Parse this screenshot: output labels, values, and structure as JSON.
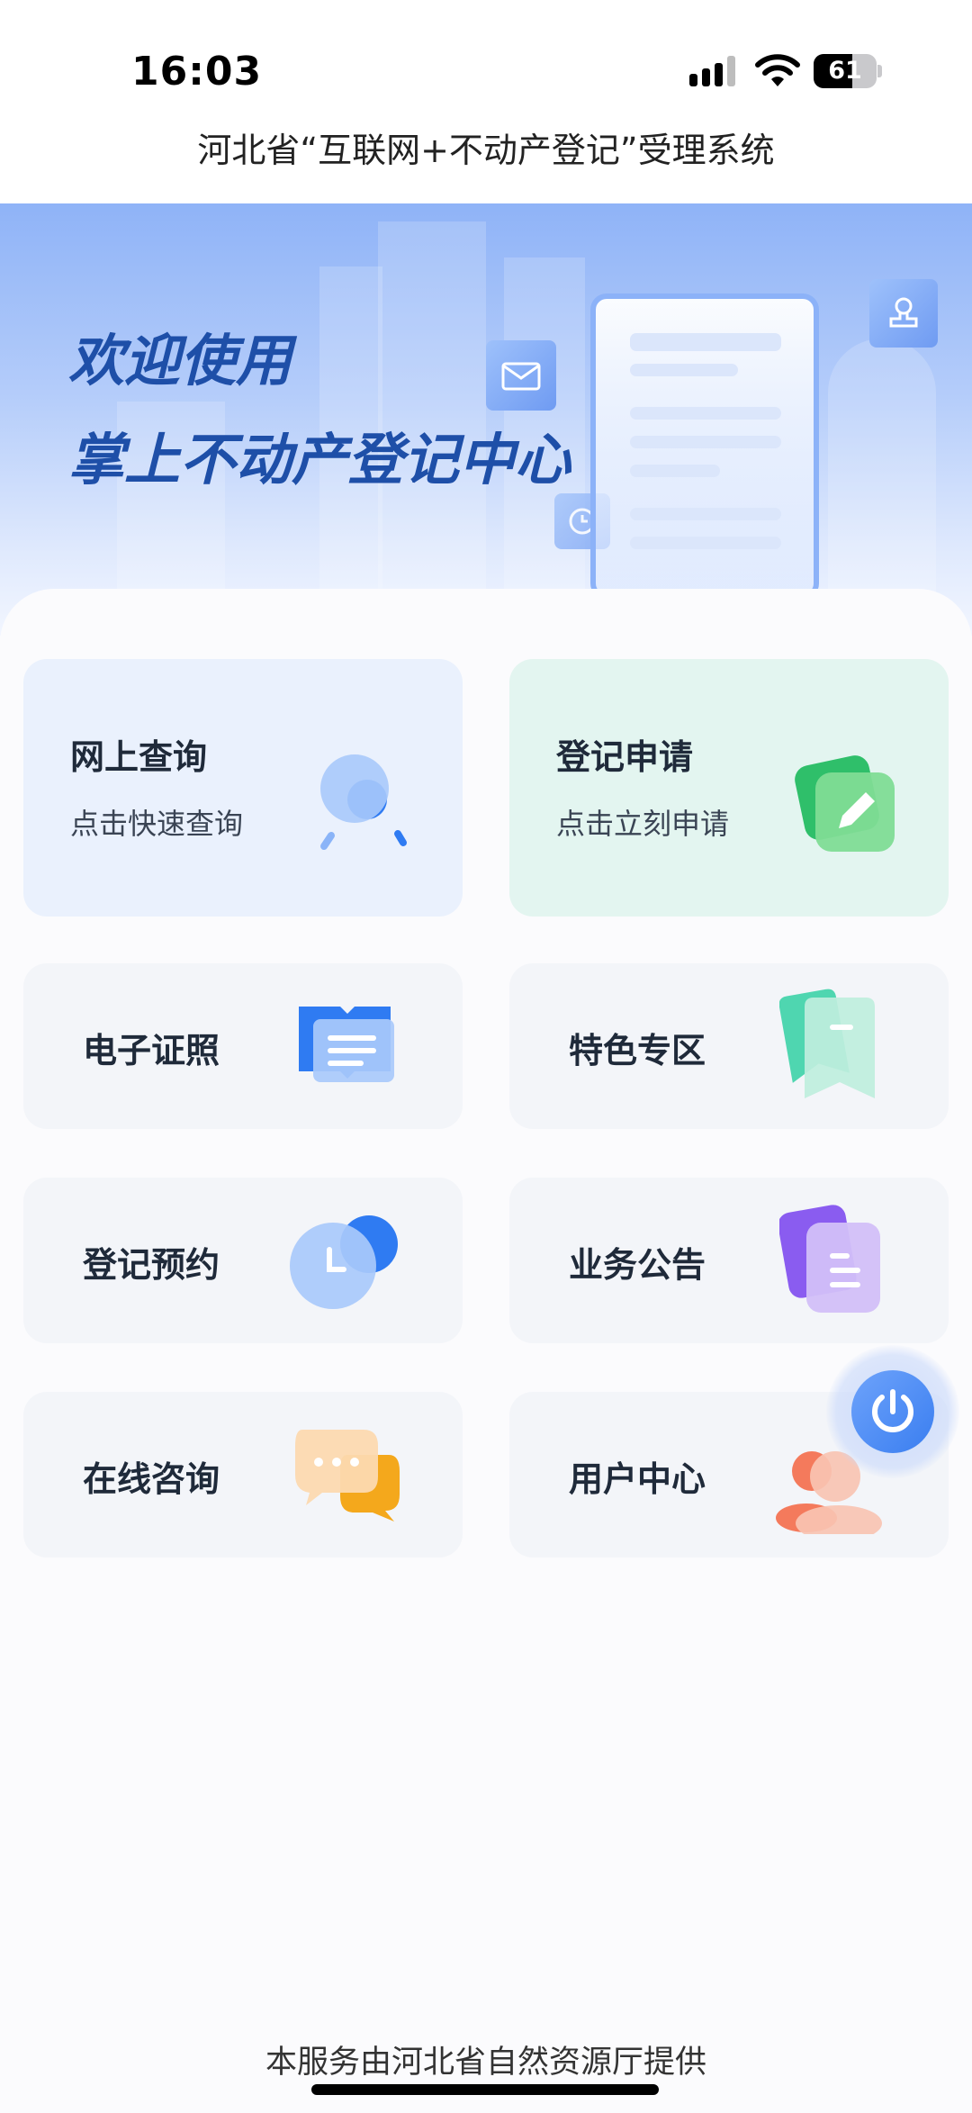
{
  "status_bar": {
    "time": "16:03",
    "battery": "61",
    "battery_level": 0.61
  },
  "header": {
    "title": "河北省“互联网+不动产登记”受理系统"
  },
  "banner": {
    "line1": "欢迎使用",
    "line2": "掌上不动产登记中心"
  },
  "tiles": [
    {
      "title": "网上查询",
      "subtitle": "点击快速查询",
      "icon": "magnifier-icon"
    },
    {
      "title": "登记申请",
      "subtitle": "点击立刻申请",
      "icon": "pencil-note-icon"
    },
    {
      "title": "电子证照",
      "icon": "open-book-icon"
    },
    {
      "title": "特色专区",
      "icon": "bookmark-icon"
    },
    {
      "title": "登记预约",
      "icon": "clock-icon"
    },
    {
      "title": "业务公告",
      "icon": "document-icon"
    },
    {
      "title": "在线咨询",
      "icon": "chat-bubble-icon"
    },
    {
      "title": "用户中心",
      "icon": "user-icon"
    }
  ],
  "fab": {
    "icon": "power-icon"
  },
  "footer": {
    "text": "本服务由河北省自然资源厅提供"
  },
  "colors": {
    "accent": "#3a7ef0",
    "banner_text": "#1e4fa8",
    "green_tile": "#e3f5f0",
    "blue_tile": "#eaf1fd"
  }
}
